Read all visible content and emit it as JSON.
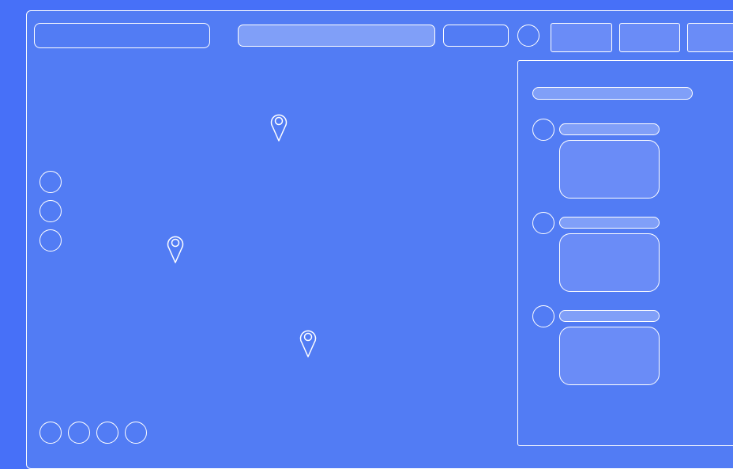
{
  "toolbar": {
    "search_field": "",
    "address_field": "",
    "filter_field": "",
    "tabs": [
      "",
      "",
      ""
    ]
  },
  "map": {
    "pins": [
      "",
      "",
      ""
    ]
  },
  "side_panel": {
    "header": "",
    "items": [
      {
        "title": "",
        "body": ""
      },
      {
        "title": "",
        "body": ""
      },
      {
        "title": "",
        "body": ""
      }
    ]
  },
  "icons": {
    "zoom_controls": [
      "circle-icon",
      "circle-icon",
      "circle-icon"
    ],
    "bottom_controls": [
      "circle-icon",
      "circle-icon",
      "circle-icon",
      "circle-icon"
    ],
    "toolbar_circle": "circle-icon",
    "pin": "map-pin-icon"
  },
  "colors": {
    "background": "#4770f8",
    "frame": "#527cf4",
    "stroke": "#ffffff",
    "fill_light": "#809ff8",
    "fill_medium": "#6a8cf7"
  }
}
